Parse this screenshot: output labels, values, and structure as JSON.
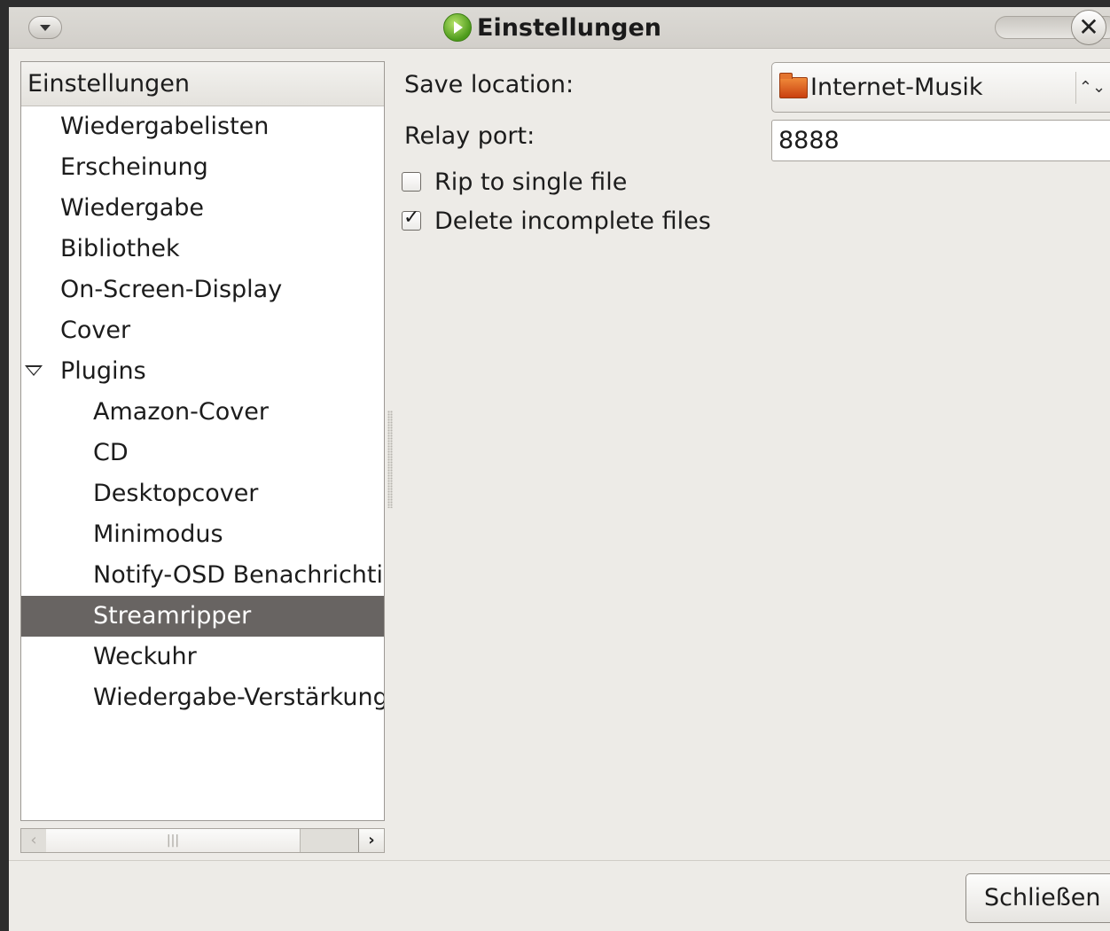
{
  "window": {
    "title": "Einstellungen",
    "close_symbol": "✕"
  },
  "tree": {
    "header": "Einstellungen",
    "items": [
      {
        "label": "Wiedergabelisten"
      },
      {
        "label": "Erscheinung"
      },
      {
        "label": "Wiedergabe"
      },
      {
        "label": "Bibliothek"
      },
      {
        "label": "On-Screen-Display"
      },
      {
        "label": "Cover"
      },
      {
        "label": "Plugins",
        "expanded": true
      },
      {
        "label": "Amazon-Cover"
      },
      {
        "label": "CD"
      },
      {
        "label": "Desktopcover"
      },
      {
        "label": "Minimodus"
      },
      {
        "label": "Notify-OSD Benachrichtig"
      },
      {
        "label": "Streamripper",
        "selected": true
      },
      {
        "label": "Weckuhr"
      },
      {
        "label": "Wiedergabe-Verstärkung"
      }
    ]
  },
  "scrollbar": {
    "left_arrow": "‹",
    "thumb_grip": "|||",
    "right_arrow": "›"
  },
  "form": {
    "save_location_label": "Save location:",
    "save_location_value": "Internet-Musik",
    "combo_arrows": "⌃⌄",
    "relay_port_label": "Relay port:",
    "relay_port_value": "8888",
    "rip_single_label": "Rip to single file",
    "rip_single_checked": false,
    "delete_incomplete_label": "Delete incomplete files",
    "delete_incomplete_checked": true,
    "check_mark": "✓"
  },
  "buttons": {
    "close_label": "Schließen"
  }
}
